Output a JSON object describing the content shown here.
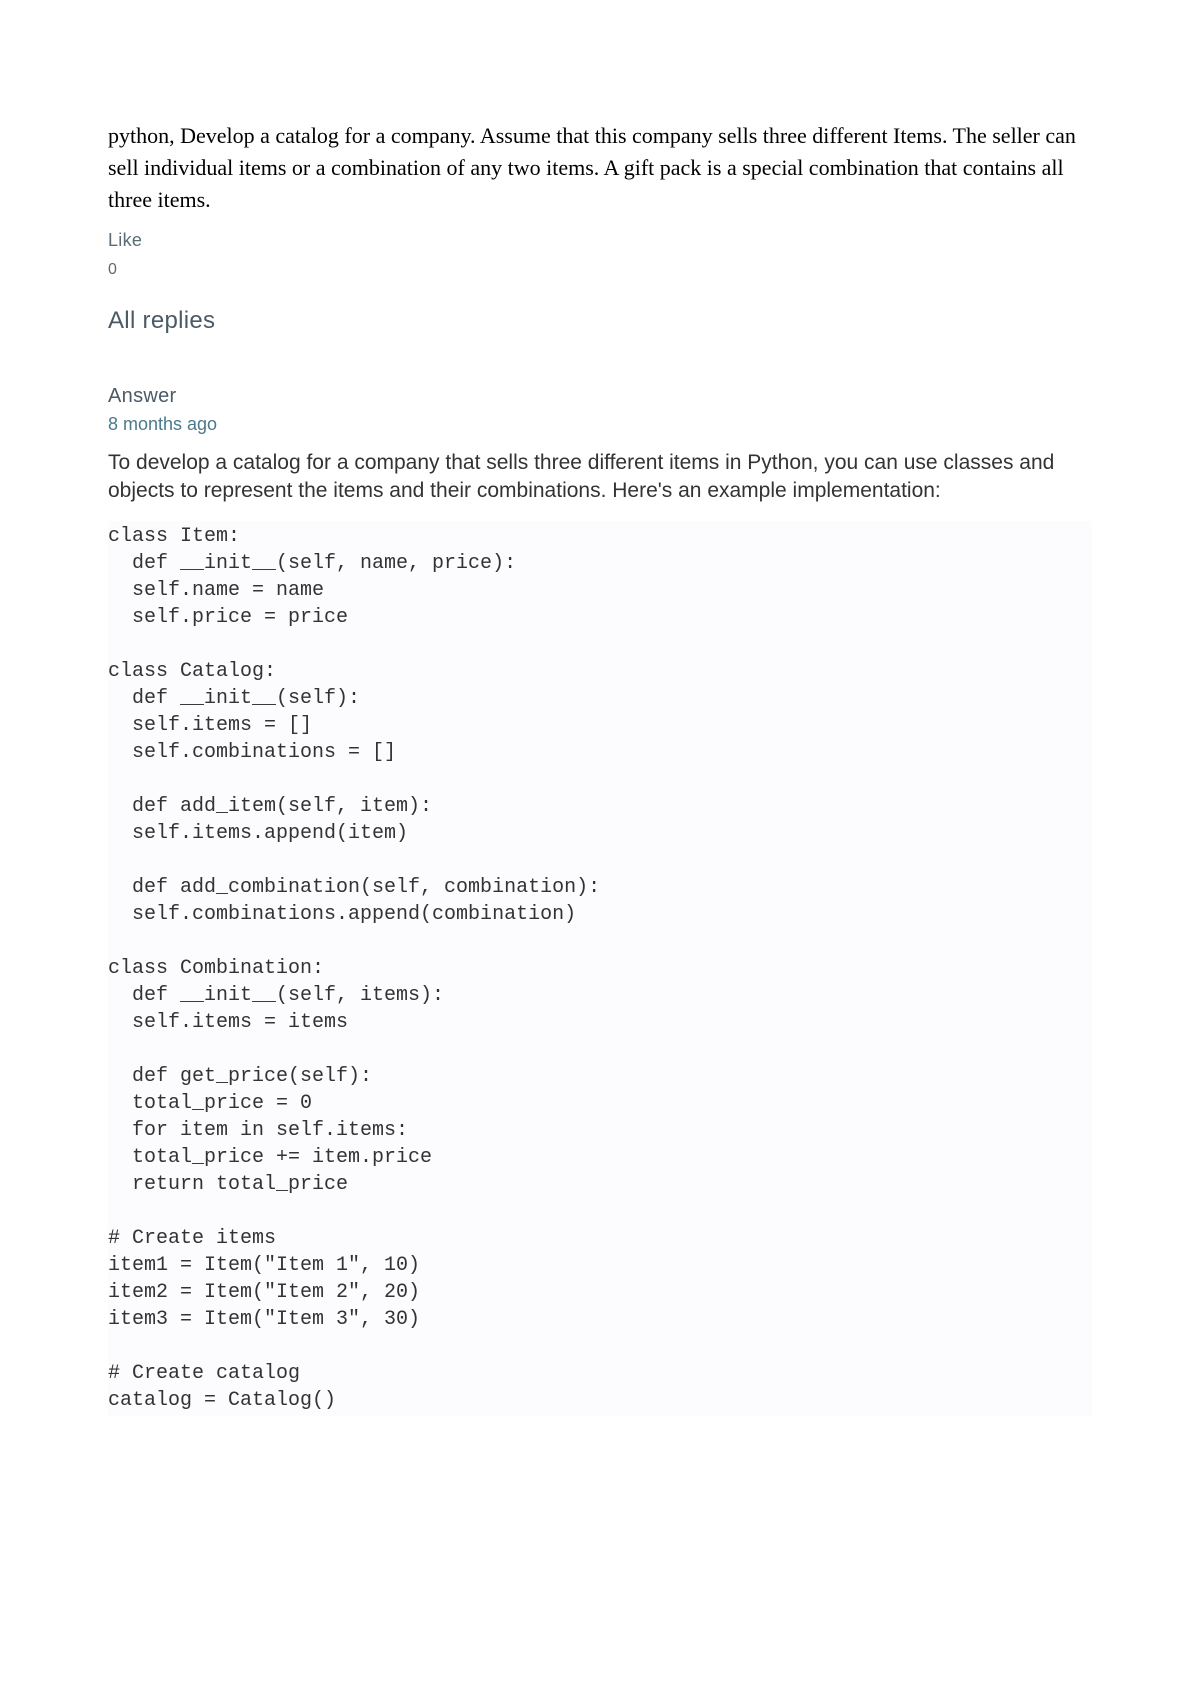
{
  "question": {
    "title": "python, Develop a catalog for a company. Assume that this company sells three different Items. The seller can sell individual items or a combination of any two items. A gift pack is a special combination that contains all three items.",
    "like_label": "Like",
    "like_count": "0"
  },
  "replies_header": "All replies",
  "answer": {
    "label": "Answer",
    "timestamp": "8 months ago",
    "intro": "To develop a catalog for a company that sells three different items in Python, you can use classes and objects to represent the items and their combinations. Here's an example implementation:",
    "code": "class Item:\n  def __init__(self, name, price):\n  self.name = name\n  self.price = price\n\nclass Catalog:\n  def __init__(self):\n  self.items = []\n  self.combinations = []\n\n  def add_item(self, item):\n  self.items.append(item)\n\n  def add_combination(self, combination):\n  self.combinations.append(combination)\n\nclass Combination:\n  def __init__(self, items):\n  self.items = items\n\n  def get_price(self):\n  total_price = 0\n  for item in self.items:\n  total_price += item.price\n  return total_price\n\n# Create items\nitem1 = Item(\"Item 1\", 10)\nitem2 = Item(\"Item 2\", 20)\nitem3 = Item(\"Item 3\", 30)\n\n# Create catalog\ncatalog = Catalog()"
  }
}
